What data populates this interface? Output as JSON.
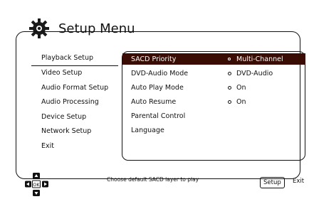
{
  "header": {
    "title": "Setup Menu",
    "icon": "gear-icon"
  },
  "sidebar": {
    "items": [
      {
        "label": "Playback Setup",
        "active": true
      },
      {
        "label": "Video Setup"
      },
      {
        "label": "Audio Format Setup"
      },
      {
        "label": "Audio Processing"
      },
      {
        "label": "Device Setup"
      },
      {
        "label": "Network Setup"
      },
      {
        "label": "Exit"
      }
    ]
  },
  "settings": {
    "rows": [
      {
        "label": "SACD Priority",
        "value": "Multi-Channel",
        "selected": true
      },
      {
        "label": "DVD-Audio Mode",
        "value": "DVD-Audio"
      },
      {
        "label": "Auto Play Mode",
        "value": "On"
      },
      {
        "label": "Auto Resume",
        "value": "On"
      },
      {
        "label": "Parental Control",
        "value": ""
      },
      {
        "label": "Language",
        "value": ""
      }
    ]
  },
  "footer": {
    "hint": "Choose default SACD layer to play",
    "ok_label": "OK",
    "setup_label": "Setup",
    "exit_label": "Exit"
  },
  "colors": {
    "selected_row_bg": "#3a0d04"
  }
}
